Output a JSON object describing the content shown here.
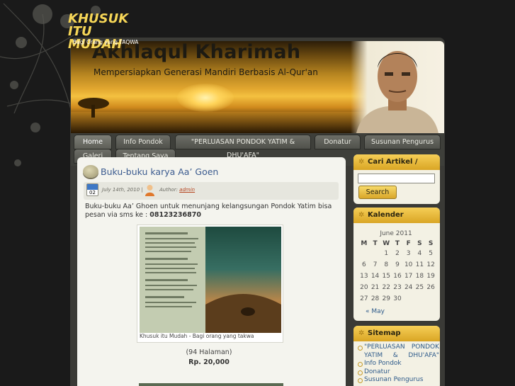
{
  "site": {
    "title": "Akhlaqul Kharimah",
    "tagline": "Mempersiapkan Generasi Mandiri Berbasis Al-Qur'an"
  },
  "nav": {
    "items": [
      {
        "label": "Home",
        "active": true
      },
      {
        "label": "Info Pondok"
      },
      {
        "label": "\"PERLUASAN PONDOK YATIM & DHU'AFA\""
      },
      {
        "label": "Donatur"
      },
      {
        "label": "Susunan Pengurus"
      },
      {
        "label": "Galeri"
      },
      {
        "label": "Tentang Saya"
      }
    ]
  },
  "post": {
    "title": "Buku-buku karya Aa’ Goen",
    "date_badge": "02",
    "date": "July 14th, 2010 |",
    "author_label": "Author:",
    "author": "admin",
    "body": "Buku-buku Aa’ Ghoen untuk menunjang kelangsungan Pondok Yatim bisa pesan via sms ke :",
    "phone": "08123236870",
    "book_title": "KHUSUK ITU MUDAH",
    "book_subtitle": "Bagi Orang yang TAQWA",
    "caption": "Khusuk itu Mudah - Bagi orang yang takwa",
    "pages": "(94 Halaman)",
    "price": "Rp. 20,000"
  },
  "sidebar": {
    "search": {
      "heading": "Cari Artikel / Kutipan",
      "button": "Search",
      "value": ""
    },
    "calendar": {
      "heading": "Kalender",
      "month": "June 2011",
      "weekdays": [
        "M",
        "T",
        "W",
        "T",
        "F",
        "S",
        "S"
      ],
      "weeks": [
        [
          "",
          "",
          "1",
          "2",
          "3",
          "4",
          "5"
        ],
        [
          "6",
          "7",
          "8",
          "9",
          "10",
          "11",
          "12"
        ],
        [
          "13",
          "14",
          "15",
          "16",
          "17",
          "18",
          "19"
        ],
        [
          "20",
          "21",
          "22",
          "23",
          "24",
          "25",
          "26"
        ],
        [
          "27",
          "28",
          "29",
          "30",
          "",
          "",
          ""
        ]
      ],
      "prev": "« May"
    },
    "sitemap": {
      "heading": "Sitemap",
      "items": [
        "\"PERLUASAN PONDOK YATIM & DHU'AFA\"",
        "Info Pondok",
        "Donatur",
        "Susunan Pengurus"
      ]
    }
  }
}
